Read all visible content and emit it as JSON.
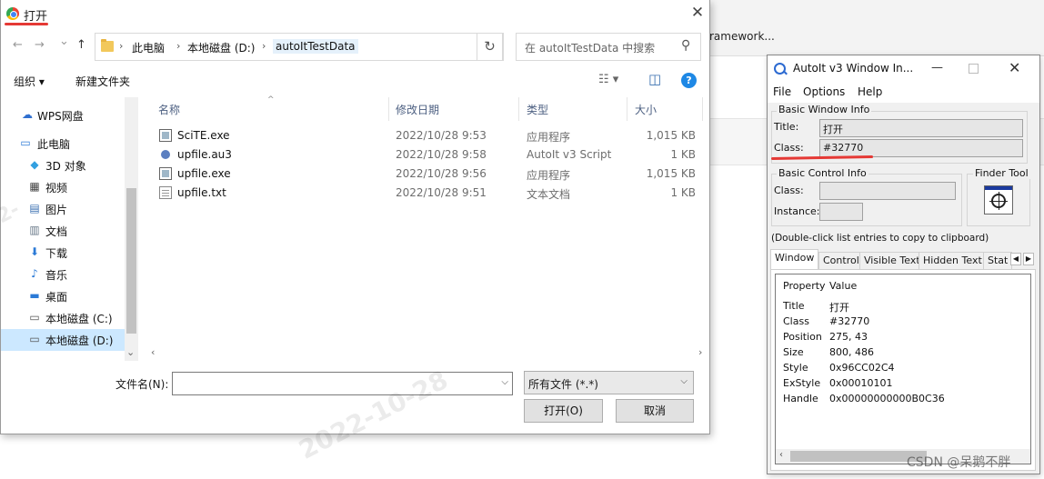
{
  "background": {
    "framework_text": "ramework..."
  },
  "open_dialog": {
    "title": "打开",
    "nav": {
      "back": "←",
      "forward": "→",
      "dropdown": "⌄",
      "up": "↑"
    },
    "address": {
      "crumbs": [
        "此电脑",
        "本地磁盘 (D:)",
        "autoItTestData"
      ],
      "sep": "›"
    },
    "refresh": "↻",
    "search_placeholder": "在 autoItTestData 中搜索",
    "search_icon": "⚲",
    "toolbar": {
      "organize": "组织 ▾",
      "new_folder": "新建文件夹",
      "view": "☷ ▾",
      "pane": "◫",
      "help": "?"
    },
    "nav_pane": [
      {
        "icon": "cloud-icon",
        "glyph": "☁",
        "label": "WPS网盘",
        "color": "#2f6fcf"
      },
      {
        "icon": "computer-icon",
        "glyph": "▭",
        "label": "此电脑",
        "color": "#2b7ad6"
      },
      {
        "icon": "3d-objects-icon",
        "glyph": "◆",
        "label": "3D 对象",
        "color": "#32a0e0"
      },
      {
        "icon": "video-icon",
        "glyph": "▦",
        "label": "视频",
        "color": "#444"
      },
      {
        "icon": "picture-icon",
        "glyph": "▤",
        "label": "图片",
        "color": "#3a6fb0"
      },
      {
        "icon": "document-icon",
        "glyph": "▥",
        "label": "文档",
        "color": "#6a7a8a"
      },
      {
        "icon": "download-icon",
        "glyph": "⬇",
        "label": "下载",
        "color": "#2b7ad6"
      },
      {
        "icon": "music-icon",
        "glyph": "♪",
        "label": "音乐",
        "color": "#2b7ad6"
      },
      {
        "icon": "desktop-icon",
        "glyph": "▬",
        "label": "桌面",
        "color": "#2b7ad6"
      },
      {
        "icon": "drive-c-icon",
        "glyph": "▭",
        "label": "本地磁盘 (C:)",
        "color": "#555"
      },
      {
        "icon": "drive-d-icon",
        "glyph": "▭",
        "label": "本地磁盘 (D:)",
        "color": "#555"
      }
    ],
    "columns": [
      "名称",
      "修改日期",
      "类型",
      "大小"
    ],
    "sort_caret": "^",
    "files": [
      {
        "name": "SciTE.exe",
        "date": "2022/10/28 9:53",
        "type": "应用程序",
        "size": "1,015 KB",
        "icon": "exe-icon"
      },
      {
        "name": "upfile.au3",
        "date": "2022/10/28 9:58",
        "type": "AutoIt v3 Script",
        "size": "1 KB",
        "icon": "au3-icon"
      },
      {
        "name": "upfile.exe",
        "date": "2022/10/28 9:56",
        "type": "应用程序",
        "size": "1,015 KB",
        "icon": "exe-icon"
      },
      {
        "name": "upfile.txt",
        "date": "2022/10/28 9:51",
        "type": "文本文档",
        "size": "1 KB",
        "icon": "txt-icon"
      }
    ],
    "filename_label": "文件名(N):",
    "filename_value": "",
    "filetype": "所有文件 (*.*)",
    "open_button": "打开(O)",
    "cancel_button": "取消",
    "watermark": "2022-10-28",
    "watermark_partial": "2-"
  },
  "autoit": {
    "title": "AutoIt v3 Window In...",
    "menu": [
      "File",
      "Options",
      "Help"
    ],
    "basic_window": {
      "label": "Basic Window Info",
      "title_label": "Title:",
      "title_value": "打开",
      "class_label": "Class:",
      "class_value": "#32770"
    },
    "basic_control": {
      "label": "Basic Control Info",
      "class_label": "Class:",
      "instance_label": "Instance:",
      "class_value": "",
      "instance_value": ""
    },
    "finder_label": "Finder Tool",
    "hint": "(Double-click list entries to copy to clipboard)",
    "tabs": [
      "Window",
      "Control",
      "Visible Text",
      "Hidden Text",
      "Stat"
    ],
    "table_headers": [
      "Property",
      "Value"
    ],
    "rows": [
      {
        "prop": "Title",
        "value": "打开"
      },
      {
        "prop": "Class",
        "value": "#32770"
      },
      {
        "prop": "Position",
        "value": "275, 43"
      },
      {
        "prop": "Size",
        "value": "800, 486"
      },
      {
        "prop": "Style",
        "value": "0x96CC02C4"
      },
      {
        "prop": "ExStyle",
        "value": "0x00010101"
      },
      {
        "prop": "Handle",
        "value": "0x00000000000B0C36"
      }
    ]
  },
  "credit": "CSDN @呆鹅不胖"
}
